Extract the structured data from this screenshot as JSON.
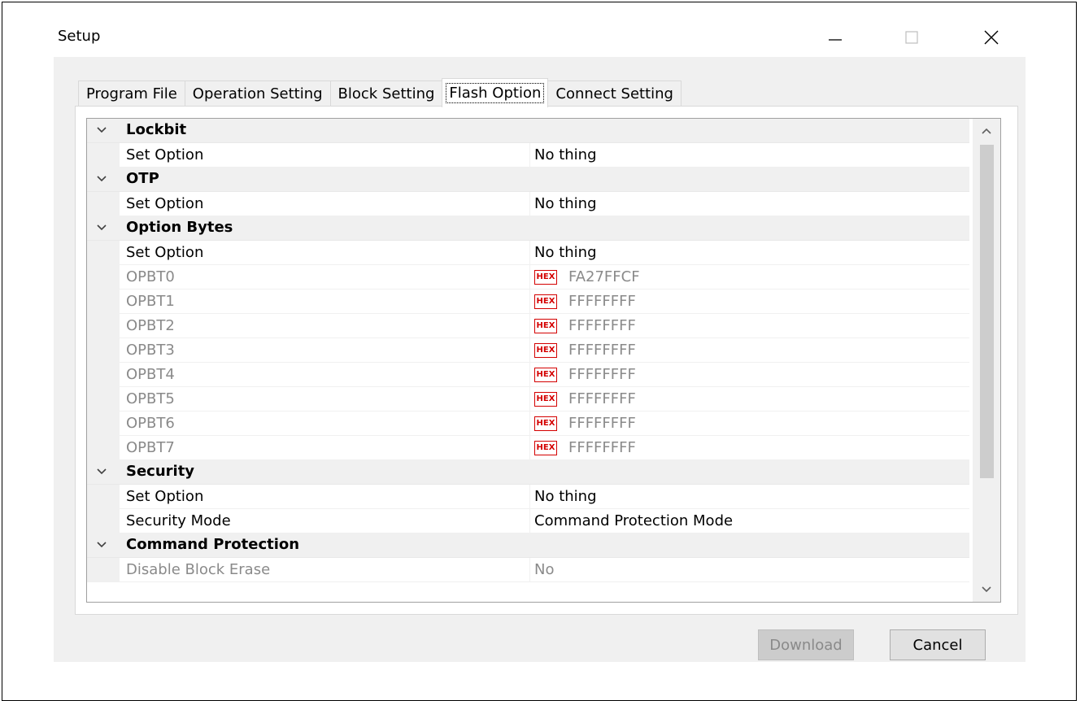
{
  "window": {
    "title": "Setup",
    "controls": [
      "minimize-icon",
      "maximize-icon",
      "close-icon"
    ]
  },
  "tabs": [
    {
      "label": "Program File",
      "active": false
    },
    {
      "label": "Operation Setting",
      "active": false
    },
    {
      "label": "Block Setting",
      "active": false
    },
    {
      "label": "Flash Option",
      "active": true
    },
    {
      "label": "Connect Setting",
      "active": false
    }
  ],
  "grid": {
    "categories": [
      {
        "label": "Lockbit",
        "rows": [
          {
            "name": "Set Option",
            "value": "No thing"
          }
        ]
      },
      {
        "label": "OTP",
        "rows": [
          {
            "name": "Set Option",
            "value": "No thing"
          }
        ]
      },
      {
        "label": "Option Bytes",
        "rows": [
          {
            "name": "Set Option",
            "value": "No thing"
          },
          {
            "name": "OPBT0",
            "value": "FA27FFCF",
            "hex": true,
            "disabled": true
          },
          {
            "name": "OPBT1",
            "value": "FFFFFFFF",
            "hex": true,
            "disabled": true
          },
          {
            "name": "OPBT2",
            "value": "FFFFFFFF",
            "hex": true,
            "disabled": true
          },
          {
            "name": "OPBT3",
            "value": "FFFFFFFF",
            "hex": true,
            "disabled": true
          },
          {
            "name": "OPBT4",
            "value": "FFFFFFFF",
            "hex": true,
            "disabled": true
          },
          {
            "name": "OPBT5",
            "value": "FFFFFFFF",
            "hex": true,
            "disabled": true
          },
          {
            "name": "OPBT6",
            "value": "FFFFFFFF",
            "hex": true,
            "disabled": true
          },
          {
            "name": "OPBT7",
            "value": "FFFFFFFF",
            "hex": true,
            "disabled": true
          }
        ]
      },
      {
        "label": "Security",
        "rows": [
          {
            "name": "Set Option",
            "value": "No thing"
          },
          {
            "name": "Security Mode",
            "value": "Command Protection Mode"
          }
        ]
      },
      {
        "label": "Command Protection",
        "rows": [
          {
            "name": "Disable Block Erase",
            "value": "No",
            "disabled": true
          }
        ]
      }
    ],
    "hex_badge_label": "HEX",
    "scroll_icons": [
      "chevron-up-icon",
      "chevron-down-icon"
    ]
  },
  "buttons": {
    "download": "Download",
    "cancel": "Cancel"
  },
  "colors": {
    "hex_badge": "#d40000",
    "disabled_text": "#8a8a8a",
    "category_bg": "#f0f0f0"
  }
}
